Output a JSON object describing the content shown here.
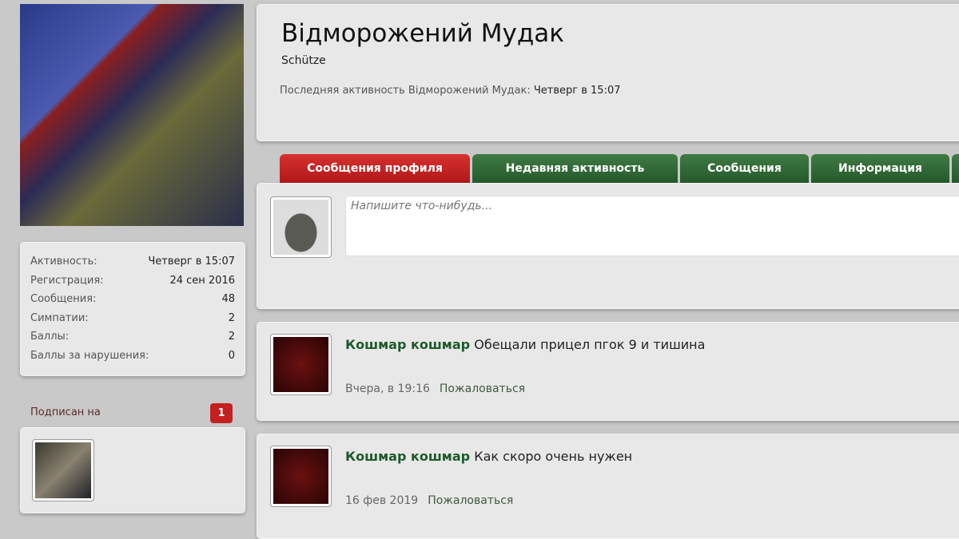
{
  "profile": {
    "name": "Відморожений Мудак",
    "title": "Schütze",
    "last_activity_label": "Последняя активность Відморожений Мудак:",
    "last_activity_value": "Четверг в 15:07"
  },
  "stats": [
    {
      "label": "Активность:",
      "value": "Четверг в 15:07"
    },
    {
      "label": "Регистрация:",
      "value": "24 сен 2016"
    },
    {
      "label": "Сообщения:",
      "value": "48"
    },
    {
      "label": "Симпатии:",
      "value": "2"
    },
    {
      "label": "Баллы:",
      "value": "2"
    },
    {
      "label": "Баллы за нарушения:",
      "value": "0"
    }
  ],
  "following": {
    "label": "Подписан на",
    "count": "1"
  },
  "tabs": [
    {
      "label": "Сообщения профиля"
    },
    {
      "label": "Недавняя активность"
    },
    {
      "label": "Сообщения"
    },
    {
      "label": "Информация"
    }
  ],
  "composer": {
    "placeholder": "Напишите что-нибудь..."
  },
  "messages": [
    {
      "author": "Кошмар кошмар",
      "text": "Обещали прицел пгок 9 и тишина",
      "time": "Вчера, в 19:16",
      "report": "Пожаловаться"
    },
    {
      "author": "Кошмар кошмар",
      "text": "Как скоро очень нужен",
      "time": "16 фев 2019",
      "report": "Пожаловаться"
    }
  ]
}
